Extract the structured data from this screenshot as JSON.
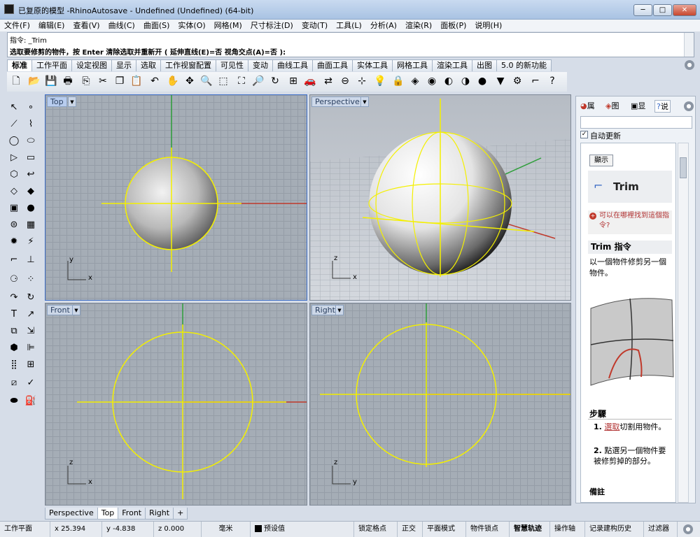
{
  "window": {
    "title": "已复原的模型 -RhinoAutosave - Undefined (Undefined) (64-bit)",
    "min": "─",
    "max": "□",
    "close": "✕"
  },
  "menu": [
    "文件(F)",
    "编辑(E)",
    "查看(V)",
    "曲线(C)",
    "曲面(S)",
    "实体(O)",
    "网格(M)",
    "尺寸标注(D)",
    "变动(T)",
    "工具(L)",
    "分析(A)",
    "渲染(R)",
    "面板(P)",
    "说明(H)"
  ],
  "command": {
    "history": "指令: _Trim",
    "prompt": "选取要修剪的物件，按 Enter 清除选取并重新开 ( 延伸直线(E)=否  视角交点(A)=否 ):"
  },
  "tabs": [
    "标准",
    "工作平面",
    "设定视图",
    "显示",
    "选取",
    "工作视窗配置",
    "可见性",
    "变动",
    "曲线工具",
    "曲面工具",
    "实体工具",
    "网格工具",
    "渲染工具",
    "出图",
    "5.0 的新功能"
  ],
  "viewports": {
    "top": "Top",
    "perspective": "Perspective",
    "front": "Front",
    "right": "Right"
  },
  "axes": {
    "x": "x",
    "y": "y",
    "z": "z"
  },
  "viewport_tabs": [
    "Perspective",
    "Top",
    "Front",
    "Right"
  ],
  "add_tab": "+",
  "status": {
    "cplane": "工作平面",
    "x": "x 25.394",
    "y": "y -4.838",
    "z": "z 0.000",
    "unit": "毫米",
    "layer": "预设值",
    "snap": "锁定格点",
    "ortho": "正交",
    "planar": "平面模式",
    "osnap": "物件锁点",
    "smarttrack": "智慧轨迹",
    "gumball": "操作轴",
    "history": "记录建构历史",
    "filter": "过滤器"
  },
  "panel": {
    "tabs": [
      "属",
      "图",
      "显",
      "说"
    ],
    "auto_update": "自动更新",
    "show_button": "顯示",
    "cmd_title": "Trim",
    "where_link": "可以在哪裡找到這個指令?",
    "cmd_header": "Trim 指令",
    "desc": "以一個物件修剪另一個物件。",
    "steps_title": "步驟",
    "steps": [
      {
        "num": "1.",
        "link": "選取",
        "text": "切割用物件。"
      },
      {
        "num": "2.",
        "link": "",
        "text": "點選另一個物件要被修剪掉的部分。"
      }
    ],
    "more": "備註"
  },
  "colors": {
    "accent": "#3d6ec7",
    "curve": "#f4f000",
    "xaxis": "#c0392b",
    "yaxis": "#2e9e3a"
  }
}
